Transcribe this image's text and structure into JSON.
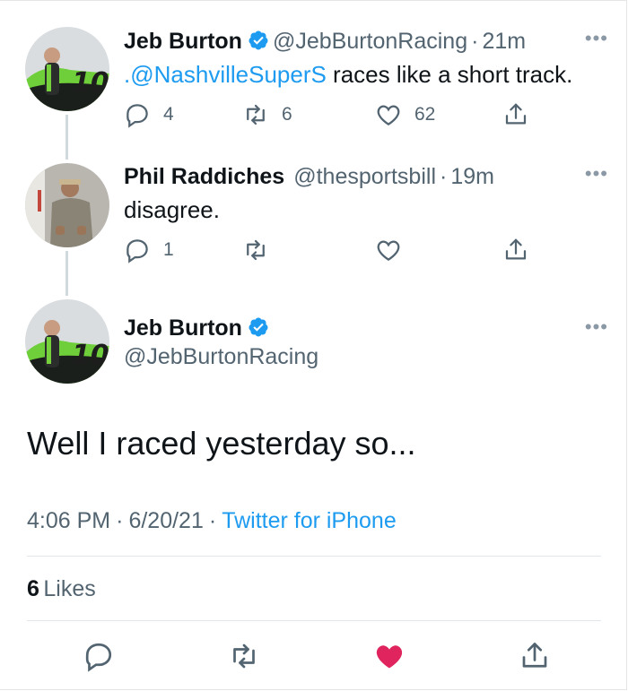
{
  "tweets": [
    {
      "name": "Jeb Burton",
      "handle": "@JebBurtonRacing",
      "time": "21m",
      "mention": ".@NashvilleSuperS",
      "text": " races like a short track.",
      "replies": "4",
      "retweets": "6",
      "likes": "62"
    },
    {
      "name": "Phil Raddiches",
      "handle": "@thesportsbill",
      "time": "19m",
      "text": "disagree.",
      "replies": "1"
    }
  ],
  "main": {
    "name": "Jeb Burton",
    "handle": "@JebBurtonRacing",
    "text": "Well I raced yesterday so...",
    "time": "4:06 PM",
    "date": "6/20/21",
    "source": "Twitter for iPhone",
    "likes_count": "6",
    "likes_label": "Likes"
  },
  "avatar_car_number": "10",
  "separator": "·",
  "colors": {
    "accent": "#1d9bf0",
    "like_red": "#e0245e",
    "verified": "#1d9bf0",
    "muted": "#536471"
  }
}
